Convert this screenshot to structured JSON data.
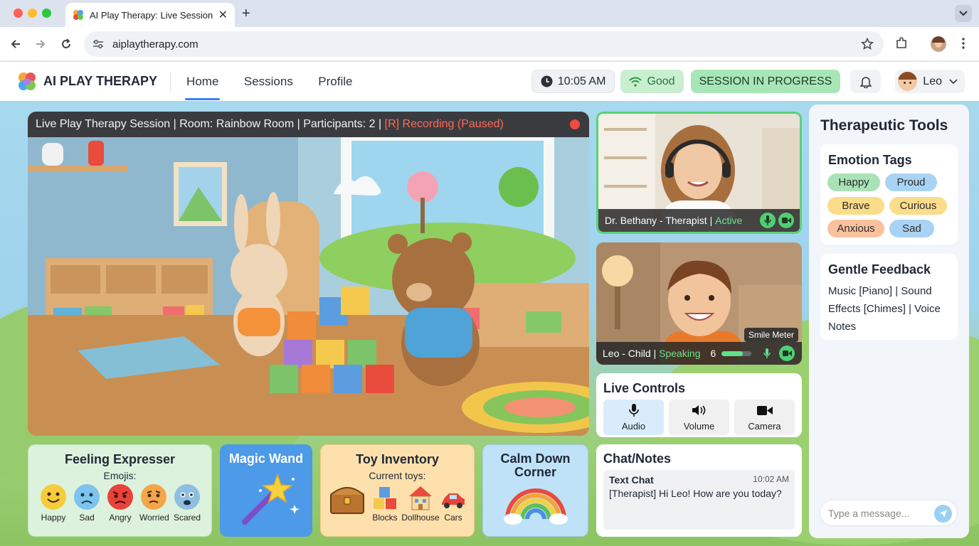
{
  "browser": {
    "tab_title": "AI Play Therapy: Live Session",
    "url": "aiplaytherapy.com"
  },
  "header": {
    "brand": "AI PLAY THERAPY",
    "nav": [
      "Home",
      "Sessions",
      "Profile"
    ],
    "time": "10:05 AM",
    "connection": "Good",
    "session_status": "SESSION IN PROGRESS",
    "user_name": "Leo"
  },
  "main_video": {
    "title": "Live Play Therapy Session | Room: Rainbow Room | Participants: 2 |",
    "recording": "[R] Recording (Paused)"
  },
  "therapist_video": {
    "name": "Dr. Bethany - Therapist |",
    "status": "Active"
  },
  "child_video": {
    "name": "Leo - Child |",
    "status": "Speaking",
    "smile_meter_label": "Smile Meter",
    "smile_value": "6",
    "smile_fraction": 0.7
  },
  "live_controls": {
    "title": "Live Controls",
    "buttons": [
      "Audio",
      "Volume",
      "Camera"
    ]
  },
  "feeling_expresser": {
    "title": "Feeling Expresser",
    "subtitle": "Emojis:",
    "emojis": [
      "Happy",
      "Sad",
      "Angry",
      "Worried",
      "Scared"
    ]
  },
  "magic_wand": {
    "title": "Magic Wand"
  },
  "toy_inventory": {
    "title": "Toy Inventory",
    "subtitle": "Current toys:",
    "toys": [
      "Blocks",
      "Dollhouse",
      "Cars"
    ]
  },
  "calm_down": {
    "title_line1": "Calm Down",
    "title_line2": "Corner"
  },
  "chat": {
    "title": "Chat/Notes",
    "label": "Text Chat",
    "time": "10:02 AM",
    "message": "[Therapist] Hi Leo! How are you today?",
    "placeholder": "Type a message..."
  },
  "tools": {
    "title": "Therapeutic Tools",
    "emotion_title": "Emotion Tags",
    "emotion_tags": [
      "Happy",
      "Proud",
      "Brave",
      "Curious",
      "Anxious",
      "Sad"
    ],
    "feedback_title": "Gentle Feedback",
    "feedback_text": "Music [Piano] | Sound Effects [Chimes] | Voice Notes"
  },
  "colors": {
    "accent": "#3b82f6",
    "session_green": "#a8e6b8",
    "status_green": "#6be38a",
    "recording_red": "#ff6b5a"
  }
}
